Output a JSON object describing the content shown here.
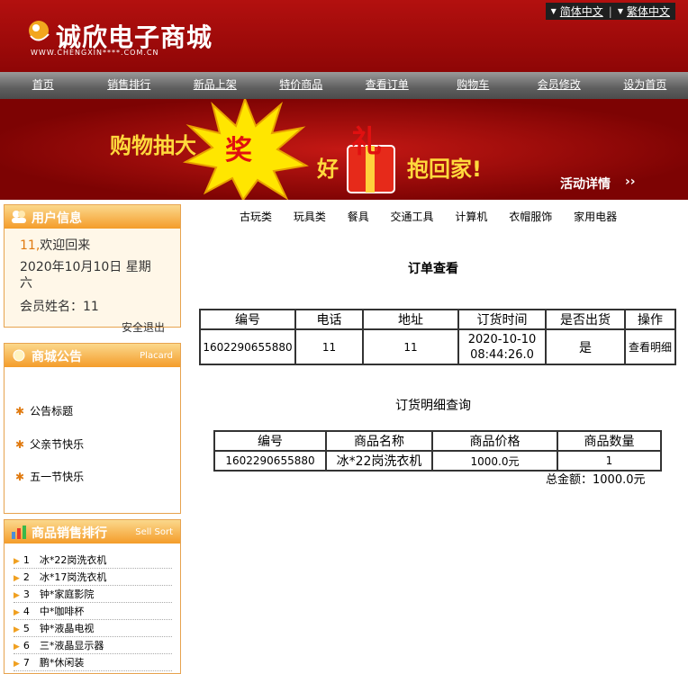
{
  "header": {
    "logo_text": "诚欣电子商城",
    "logo_url": "WWW.CHENGXIN****.COM.CN",
    "lang_simplified": "简体中文",
    "lang_traditional": "繁体中文"
  },
  "nav": [
    {
      "label": "首页"
    },
    {
      "label": "销售排行"
    },
    {
      "label": "新品上架"
    },
    {
      "label": "特价商品"
    },
    {
      "label": "查看订单"
    },
    {
      "label": "购物车"
    },
    {
      "label": "会员修改"
    },
    {
      "label": "设为首页"
    }
  ],
  "banner": {
    "line1": "购物抽大",
    "burst": "奖",
    "line2a": "好",
    "gift": "礼",
    "line2b": "抱回家!",
    "details": "活动详情"
  },
  "user_info": {
    "title": "用户信息",
    "welcome_id": "11,",
    "welcome": "欢迎回来",
    "date": "2020年10月10日  星期",
    "weekday": "六",
    "member_name": "会员姓名：11",
    "logout": "安全退出"
  },
  "notice": {
    "title": "商城公告",
    "en": "Placard",
    "items": [
      "公告标题",
      "父亲节快乐",
      "五一节快乐"
    ]
  },
  "sell_rank": {
    "title": "商品销售排行",
    "en": "Sell Sort",
    "items": [
      {
        "no": "1",
        "name": "冰*22岗洗衣机"
      },
      {
        "no": "2",
        "name": "冰*17岗洗衣机"
      },
      {
        "no": "3",
        "name": "钟*家庭影院"
      },
      {
        "no": "4",
        "name": "中*咖啡杯"
      },
      {
        "no": "5",
        "name": "钟*液晶电视"
      },
      {
        "no": "6",
        "name": "三*液晶显示器"
      },
      {
        "no": "7",
        "name": "鹏*休闲装"
      }
    ]
  },
  "categories": [
    "古玩类",
    "玩具类",
    "餐具",
    "交通工具",
    "计算机",
    "衣帽服饰",
    "家用电器"
  ],
  "order": {
    "title": "订单查看",
    "headers": [
      "编号",
      "电话",
      "地址",
      "订货时间",
      "是否出货",
      "操作"
    ],
    "row": {
      "id": "1602290655880",
      "phone": "11",
      "address": "11",
      "time_date": "2020-10-10",
      "time_clock": "08:44:26.0",
      "shipped": "是",
      "action": "查看明细"
    }
  },
  "detail": {
    "title": "订货明细查询",
    "headers": [
      "编号",
      "商品名称",
      "商品价格",
      "商品数量"
    ],
    "row": {
      "id": "1602290655880",
      "name": "冰*22岗洗衣机",
      "price": "1000.0元",
      "qty": "1"
    },
    "total": "总金额：1000.0元"
  },
  "colors": {
    "header_red": "#a80a0a",
    "orange": "#f49c2a",
    "nav_gray": "#5e5e5e"
  }
}
